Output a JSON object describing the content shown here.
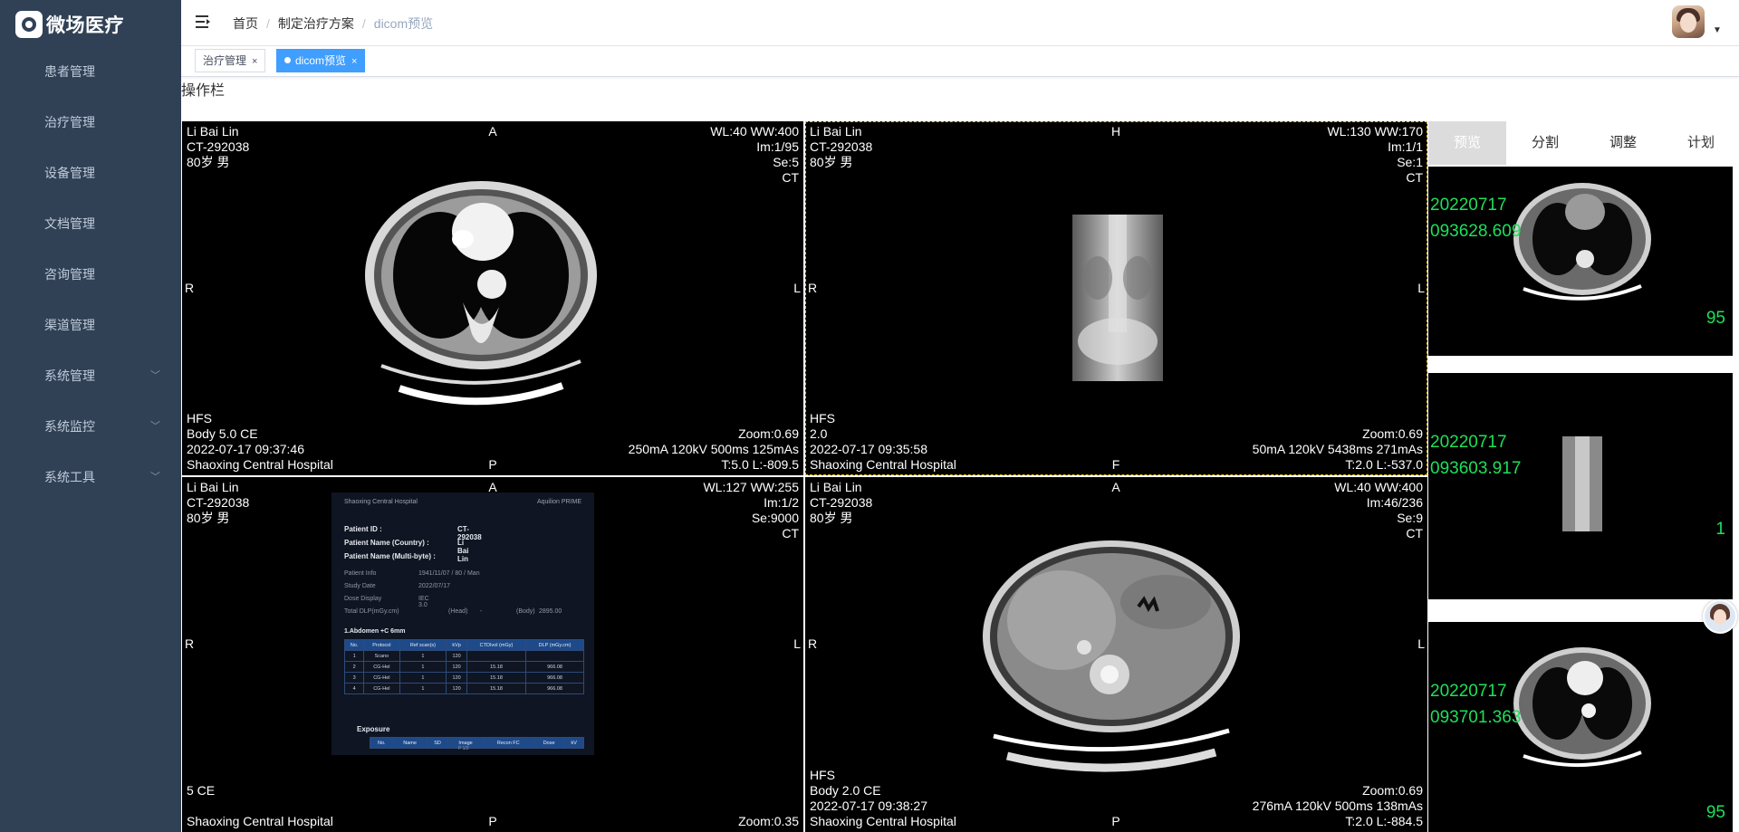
{
  "app": {
    "logo_text": "微场医疗"
  },
  "sidebar": {
    "items": [
      {
        "label": "患者管理",
        "submenu": false
      },
      {
        "label": "治疗管理",
        "submenu": false
      },
      {
        "label": "设备管理",
        "submenu": false
      },
      {
        "label": "文档管理",
        "submenu": false
      },
      {
        "label": "咨询管理",
        "submenu": false
      },
      {
        "label": "渠道管理",
        "submenu": false
      },
      {
        "label": "系统管理",
        "submenu": true
      },
      {
        "label": "系统监控",
        "submenu": true
      },
      {
        "label": "系统工具",
        "submenu": true
      }
    ]
  },
  "breadcrumb": {
    "home": "首页",
    "mid": "制定治疗方案",
    "current": "dicom预览",
    "sep": "/"
  },
  "tags": [
    {
      "label": "治疗管理",
      "close": "×"
    },
    {
      "label": "dicom预览",
      "close": "×"
    }
  ],
  "toolbar": {
    "title": "操作栏"
  },
  "viewers": [
    {
      "name": "Li Bai Lin",
      "id": "CT-292038",
      "age": "80岁 男",
      "wlww": "WL:40 WW:400",
      "im": "Im:1/95",
      "se": "Se:5",
      "modality": "CT",
      "top": "A",
      "left": "R",
      "right": "L",
      "bottom": "P",
      "bl1": "HFS",
      "bl2": "Body 5.0 CE",
      "bl3": "2022-07-17 09:37:46",
      "bl4": "Shaoxing Central Hospital",
      "br1": "Zoom:0.69",
      "br2": "250mA 120kV 500ms 125mAs",
      "br3": "T:5.0 L:-809.5"
    },
    {
      "name": "Li Bai Lin",
      "id": "CT-292038",
      "age": "80岁 男",
      "wlww": "WL:130 WW:170",
      "im": "Im:1/1",
      "se": "Se:1",
      "modality": "CT",
      "top": "H",
      "left": "R",
      "right": "L",
      "bottom": "F",
      "bl1": "HFS",
      "bl2": "2.0",
      "bl3": "2022-07-17 09:35:58",
      "bl4": "Shaoxing Central Hospital",
      "br1": "Zoom:0.69",
      "br2": "50mA 120kV 5438ms 271mAs",
      "br3": "T:2.0 L:-537.0"
    },
    {
      "name": "Li Bai Lin",
      "id": "CT-292038",
      "age": "80岁 男",
      "wlww": "WL:127 WW:255",
      "im": "Im:1/2",
      "se": "Se:9000",
      "modality": "CT",
      "top": "A",
      "left": "R",
      "right": "L",
      "bottom": "P",
      "bl1": "5 CE",
      "bl4": "Shaoxing Central Hospital",
      "br1": "Zoom:0.35"
    },
    {
      "name": "Li Bai Lin",
      "id": "CT-292038",
      "age": "80岁 男",
      "wlww": "WL:40 WW:400",
      "im": "Im:46/236",
      "se": "Se:9",
      "modality": "CT",
      "top": "A",
      "left": "R",
      "right": "L",
      "bottom": "P",
      "bl1": "HFS",
      "bl2": "Body 2.0 CE",
      "bl3": "2022-07-17 09:38:27",
      "bl4": "Shaoxing Central Hospital",
      "br1": "Zoom:0.69",
      "br2": "276mA 120kV 500ms 138mAs",
      "br3": "T:2.0 L:-884.5"
    }
  ],
  "report": {
    "hospital": "Shaoxing Central Hospital",
    "device": "Aquilion PRIME",
    "patient_id_label": "Patient ID :",
    "patient_id": "CT-292038",
    "patient_name_label": "Patient Name (Country) :",
    "patient_name": "Li Bai Lin",
    "patient_name_mb": "Patient Name (Multi-byte) :",
    "info_label": "Patient Info",
    "info_value": "1941/11/07 / 80 / Man",
    "date_label": "Study Date",
    "date_value": "2022/07/17",
    "dose_label": "Dose Display",
    "dose_value": "IEC 3.0",
    "dlp_label": "Total DLP(mGy.cm)",
    "dlp_head": "(Head)",
    "dlp_head_val": "-",
    "dlp_body": "(Body)",
    "dlp_body_val": "2895.00",
    "section1": "1.Abdomen +C  6mm",
    "section2": "Exposure",
    "page": "P 1/2"
  },
  "right_panel": {
    "tabs": [
      "预览",
      "分割",
      "调整",
      "计划"
    ],
    "thumbs": [
      {
        "date": "20220717",
        "time": "093628.609",
        "count": "95"
      },
      {
        "date": "20220717",
        "time": "093603.917",
        "count": "1"
      },
      {
        "date": "20220717",
        "time": "093701.363",
        "count": "95"
      }
    ]
  },
  "colors": {
    "sidebar": "#304156",
    "accent": "#409eff",
    "thumb_text": "#1ee05a"
  }
}
